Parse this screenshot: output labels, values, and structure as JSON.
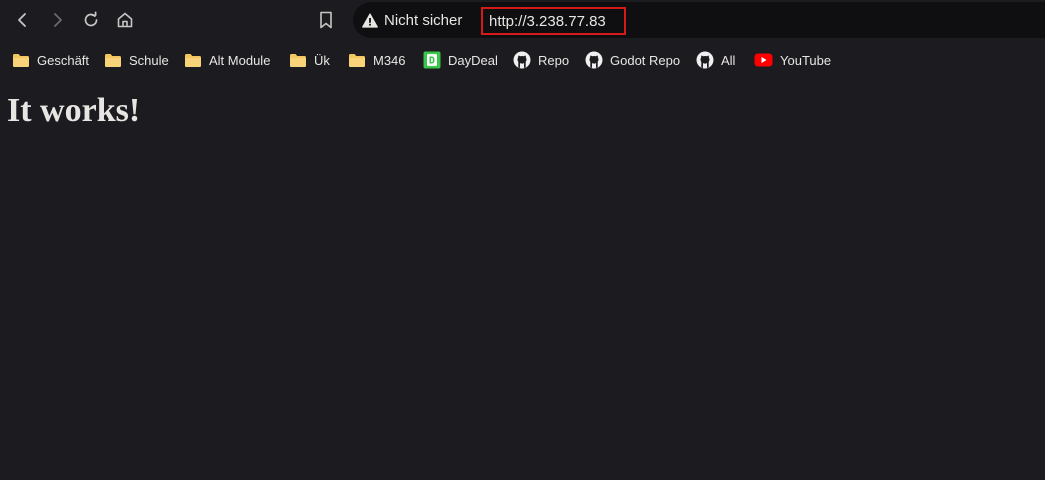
{
  "toolbar": {
    "security_label": "Nicht sicher",
    "url": "http://3.238.77.83",
    "url_highlight_color": "#d61a1a",
    "buttons": {
      "back": "back-arrow-icon",
      "forward": "forward-arrow-icon",
      "reload": "reload-icon",
      "home": "home-icon",
      "bookmark": "bookmark-icon"
    }
  },
  "bookmarks": [
    {
      "label": "Geschäft",
      "icon": "folder-icon"
    },
    {
      "label": "Schule",
      "icon": "folder-icon"
    },
    {
      "label": "Alt Module",
      "icon": "folder-icon"
    },
    {
      "label": "Ük",
      "icon": "folder-icon"
    },
    {
      "label": "M346",
      "icon": "folder-icon"
    },
    {
      "label": "DayDeal",
      "icon": "daydeal-icon"
    },
    {
      "label": "Repo",
      "icon": "github-icon"
    },
    {
      "label": "Godot Repo",
      "icon": "github-icon"
    },
    {
      "label": "All",
      "icon": "github-icon"
    },
    {
      "label": "YouTube",
      "icon": "youtube-icon"
    }
  ],
  "page": {
    "heading": "It works!",
    "background": "#1c1b1f"
  }
}
